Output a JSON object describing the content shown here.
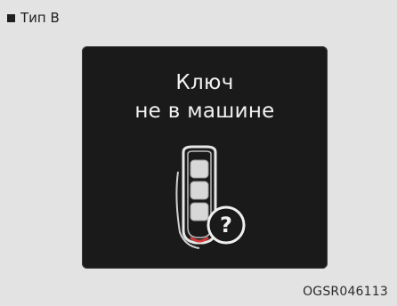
{
  "header": {
    "label": "Тип B"
  },
  "screen": {
    "line1": "Ключ",
    "line2": "не в машине",
    "icons": [
      "smart-key-icon",
      "question-mark-icon"
    ]
  },
  "figure_code": "OGSR046113",
  "colors": {
    "background": "#e3e3e4",
    "screen": "#1a1a1a",
    "text": "#f2f2f2"
  }
}
